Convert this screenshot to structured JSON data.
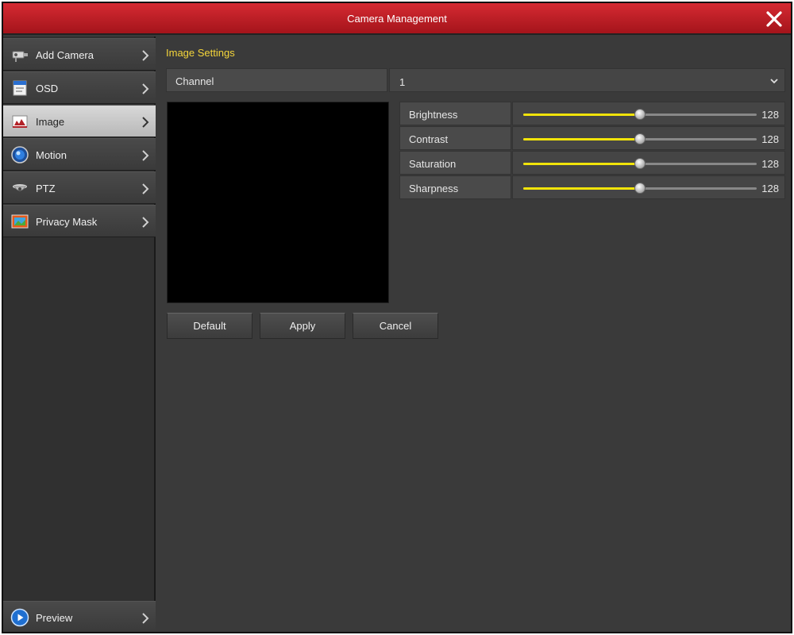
{
  "window": {
    "title": "Camera Management",
    "close_icon": "close-icon"
  },
  "sidebar": {
    "items": [
      {
        "label": "Add Camera",
        "icon": "camera-icon"
      },
      {
        "label": "OSD",
        "icon": "osd-icon"
      },
      {
        "label": "Image",
        "icon": "image-icon",
        "active": true
      },
      {
        "label": "Motion",
        "icon": "motion-icon"
      },
      {
        "label": "PTZ",
        "icon": "ptz-icon"
      },
      {
        "label": "Privacy Mask",
        "icon": "privacy-mask-icon"
      }
    ],
    "preview": {
      "label": "Preview",
      "icon": "play-icon"
    }
  },
  "main": {
    "section_title": "Image Settings",
    "channel": {
      "label": "Channel",
      "value": "1"
    },
    "adjustments": [
      {
        "label": "Brightness",
        "value": "128",
        "fraction": 0.5
      },
      {
        "label": "Contrast",
        "value": "128",
        "fraction": 0.5
      },
      {
        "label": "Saturation",
        "value": "128",
        "fraction": 0.5
      },
      {
        "label": "Sharpness",
        "value": "128",
        "fraction": 0.5
      }
    ],
    "buttons": {
      "default": "Default",
      "apply": "Apply",
      "cancel": "Cancel"
    }
  },
  "colors": {
    "title_bar": "#c01f27",
    "accent_yellow": "#f4d53a",
    "slider_fill": "#f2e40a"
  }
}
